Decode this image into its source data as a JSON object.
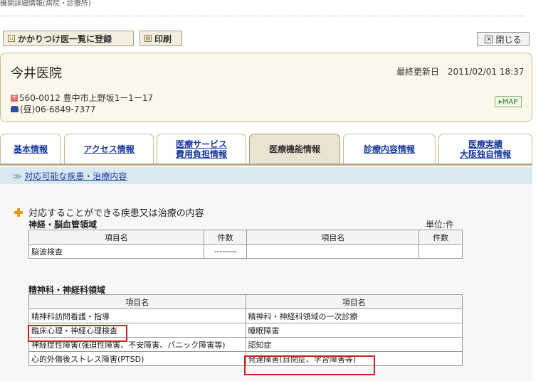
{
  "breadcrumb": "機関詳細情報(病院・診療所)",
  "toolbar": {
    "register_label": "かかりつけ医一覧に登録",
    "print_label": "印刷",
    "close_label": "閉じる"
  },
  "clinic": {
    "name": "今井医院",
    "updated_label": "最終更新日",
    "updated_value": "2011/02/01 18:37",
    "postal_address": "560-0012 豊中市上野坂1ー1ー17",
    "phone": "(昼)06-6849-7377",
    "map_label": "MAP"
  },
  "tabs": [
    {
      "line1": "基本情報",
      "line2": "",
      "active": false
    },
    {
      "line1": "アクセス情報",
      "line2": "",
      "active": false
    },
    {
      "line1": "医療サービス",
      "line2": "費用負担情報",
      "active": false
    },
    {
      "line1": "医療機能情報",
      "line2": "",
      "active": true
    },
    {
      "line1": "診療内容情報",
      "line2": "",
      "active": false
    },
    {
      "line1": "医療実績",
      "line2": "大阪独自情報",
      "active": false
    }
  ],
  "sub_link": "対応可能な疾患・治療内容",
  "section": {
    "title": "対応することができる疾患又は治療の内容",
    "unit": "単位:件",
    "neuro": {
      "label": "神経・脳血管領域",
      "headers": [
        "項目名",
        "件数",
        "項目名",
        "件数"
      ],
      "rows": [
        [
          "脳波検査",
          "--------",
          "",
          ""
        ]
      ]
    },
    "psych": {
      "label": "精神科・神経科領域",
      "headers": [
        "項目名",
        "項目名"
      ],
      "rows": [
        [
          "精神科訪問看護・指導",
          "精神科・神経科領域の一次診療"
        ],
        [
          "臨床心理・神経心理検査",
          "睡眠障害"
        ],
        [
          "神経症性障害(強迫性障害、不安障害、パニック障害等)",
          "認知症"
        ],
        [
          "心的外傷後ストレス障害(PTSD)",
          "発達障害(自閉症、学習障害等)"
        ]
      ]
    }
  },
  "colors": {
    "highlight": "#d21f1f",
    "link": "#1a3aa0",
    "card_bg": "#fbf7ea",
    "sub_bar": "#d9e8f1"
  }
}
